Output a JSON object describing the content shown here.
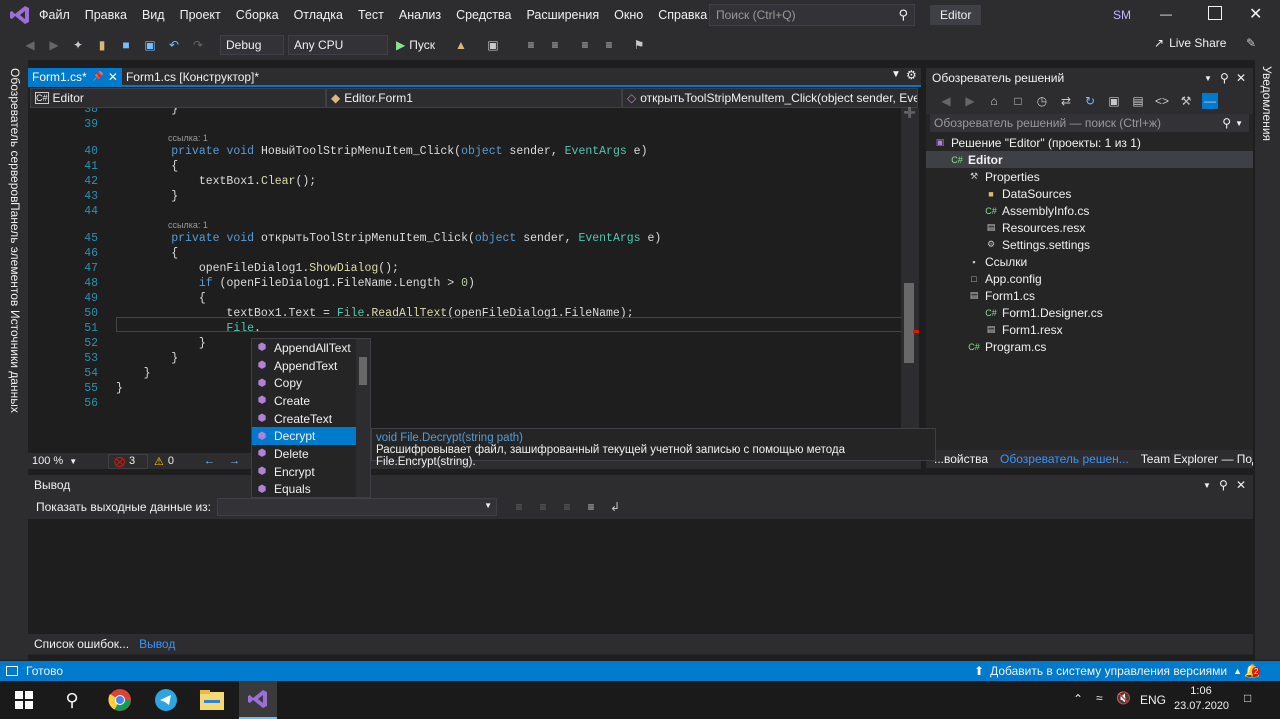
{
  "titlebar": {
    "menu": [
      "Файл",
      "Правка",
      "Вид",
      "Проект",
      "Сборка",
      "Отладка",
      "Тест",
      "Анализ",
      "Средства",
      "Расширения",
      "Окно",
      "Справка"
    ],
    "search_placeholder": "Поиск (Ctrl+Q)",
    "solution_name": "Editor",
    "user_initials": "SM"
  },
  "toolbar": {
    "config": "Debug",
    "platform": "Any CPU",
    "start_label": "Пуск",
    "live_share": "Live Share"
  },
  "left_tabs": [
    "Обозреватель серверов",
    "Панель элементов",
    "Источники данных"
  ],
  "right_tabs": [
    "Уведомления"
  ],
  "editor": {
    "tabs": [
      "Form1.cs*",
      "Form1.cs [Конструктор]*"
    ],
    "nav_project": "Editor",
    "nav_class": "Editor.Form1",
    "nav_member": "открытьToolStripMenuItem_Click(object sender, Eve",
    "zoom": "100 %",
    "errors": "3",
    "warnings": "0",
    "lines": [
      {
        "n": "38",
        "t": "        }",
        "kind": "plain"
      },
      {
        "n": "39",
        "t": "",
        "kind": "plain"
      },
      {
        "ref": "ссылка: 1"
      },
      {
        "n": "40",
        "t": "        private void НовыйToolStripMenuItem_Click(object sender, EventArgs e)",
        "kind": "sig"
      },
      {
        "n": "41",
        "t": "        {",
        "kind": "plain"
      },
      {
        "n": "42",
        "t": "            textBox1.Clear();",
        "kind": "plain"
      },
      {
        "n": "43",
        "t": "        }",
        "kind": "plain"
      },
      {
        "n": "44",
        "t": "",
        "kind": "plain"
      },
      {
        "ref": "ссылка: 1"
      },
      {
        "n": "45",
        "t": "        private void открытьToolStripMenuItem_Click(object sender, EventArgs e)",
        "kind": "sig"
      },
      {
        "n": "46",
        "t": "        {",
        "kind": "plain"
      },
      {
        "n": "47",
        "t": "            openFileDialog1.ShowDialog();",
        "kind": "plain"
      },
      {
        "n": "48",
        "t": "            if (openFileDialog1.FileName.Length > 0)",
        "kind": "plain"
      },
      {
        "n": "49",
        "t": "            {",
        "kind": "plain"
      },
      {
        "n": "50",
        "t": "                textBox1.Text = File.ReadAllText(openFileDialog1.FileName);",
        "kind": "plain"
      },
      {
        "n": "51",
        "t": "                File.",
        "kind": "plain"
      },
      {
        "n": "52",
        "t": "            }",
        "kind": "plain"
      },
      {
        "n": "53",
        "t": "        }",
        "kind": "plain"
      },
      {
        "n": "54",
        "t": "    }",
        "kind": "plain"
      },
      {
        "n": "55",
        "t": "}",
        "kind": "plain"
      },
      {
        "n": "56",
        "t": "",
        "kind": "plain"
      }
    ]
  },
  "autocomplete": {
    "items": [
      "AppendAllText",
      "AppendText",
      "Copy",
      "Create",
      "CreateText",
      "Decrypt",
      "Delete",
      "Encrypt",
      "Equals"
    ],
    "selected_index": 5,
    "tooltip_sig": "void File.Decrypt(string path)",
    "tooltip_desc": "Расшифровывает файл, зашифрованный текущей учетной записью с помощью метода File.Encrypt(string)."
  },
  "solution_explorer": {
    "title": "Обозреватель решений",
    "search_placeholder": "Обозреватель решений — поиск (Ctrl+ж)",
    "tree": [
      {
        "label": "Решение \"Editor\" (проекты: 1 из 1)",
        "depth": 0,
        "icon": "solution-icon"
      },
      {
        "label": "Editor",
        "depth": 1,
        "icon": "csproj-icon",
        "bold": true
      },
      {
        "label": "Properties",
        "depth": 2,
        "icon": "wrench-icon"
      },
      {
        "label": "DataSources",
        "depth": 3,
        "icon": "folder-icon"
      },
      {
        "label": "AssemblyInfo.cs",
        "depth": 3,
        "icon": "cs-file-icon"
      },
      {
        "label": "Resources.resx",
        "depth": 3,
        "icon": "resx-icon"
      },
      {
        "label": "Settings.settings",
        "depth": 3,
        "icon": "gear-icon"
      },
      {
        "label": "Ссылки",
        "depth": 2,
        "icon": "references-icon"
      },
      {
        "label": "App.config",
        "depth": 2,
        "icon": "config-icon"
      },
      {
        "label": "Form1.cs",
        "depth": 2,
        "icon": "form-icon"
      },
      {
        "label": "Form1.Designer.cs",
        "depth": 3,
        "icon": "cs-file-icon"
      },
      {
        "label": "Form1.resx",
        "depth": 3,
        "icon": "resx-icon"
      },
      {
        "label": "Program.cs",
        "depth": 2,
        "icon": "cs-file-icon"
      }
    ],
    "bottom_tabs": [
      "...войства",
      "Обозреватель решен...",
      "Team Explorer — Подк..."
    ]
  },
  "output": {
    "title": "Вывод",
    "show_from_label": "Показать выходные данные из:",
    "bottom_tabs": [
      "Список ошибок...",
      "Вывод"
    ]
  },
  "status": {
    "ready": "Готово",
    "vcs": "Добавить в систему управления версиями",
    "notif_count": "2"
  },
  "taskbar": {
    "lang": "ENG",
    "time": "1:06",
    "date": "23.07.2020"
  },
  "colors": {
    "accent": "#007acc",
    "editor_bg": "#1e1e1e",
    "chrome_bg": "#2d2d30"
  }
}
